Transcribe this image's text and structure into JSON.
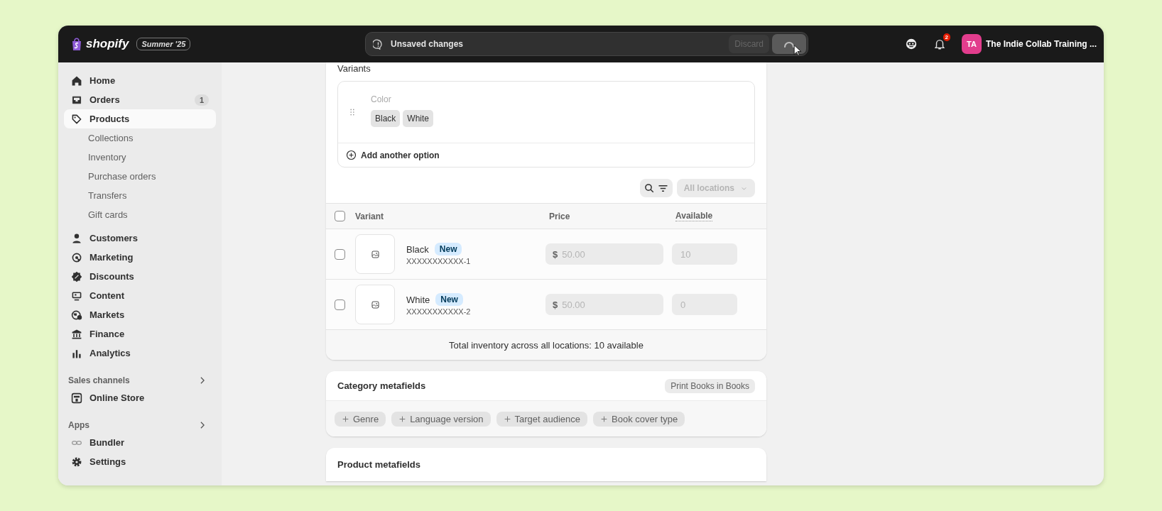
{
  "topbar": {
    "logo": "shopify",
    "edition": "Summer '25",
    "unsaved": {
      "message": "Unsaved changes",
      "discard": "Discard"
    },
    "notifications": {
      "count": "2"
    },
    "account": {
      "initials": "TA",
      "name": "The Indie Collab Training ..."
    }
  },
  "sidebar": {
    "items": [
      {
        "label": "Home",
        "kind": "home",
        "selected": false
      },
      {
        "label": "Orders",
        "kind": "orders",
        "selected": false,
        "badge": "1"
      },
      {
        "label": "Products",
        "kind": "products",
        "selected": true,
        "children": [
          {
            "label": "Collections"
          },
          {
            "label": "Inventory"
          },
          {
            "label": "Purchase orders"
          },
          {
            "label": "Transfers"
          },
          {
            "label": "Gift cards"
          }
        ]
      },
      {
        "label": "Customers",
        "kind": "customers",
        "selected": false
      },
      {
        "label": "Marketing",
        "kind": "marketing",
        "selected": false
      },
      {
        "label": "Discounts",
        "kind": "discounts",
        "selected": false
      },
      {
        "label": "Content",
        "kind": "content",
        "selected": false
      },
      {
        "label": "Markets",
        "kind": "markets",
        "selected": false
      },
      {
        "label": "Finance",
        "kind": "finance",
        "selected": false
      },
      {
        "label": "Analytics",
        "kind": "analytics",
        "selected": false
      }
    ],
    "sections": [
      {
        "title": "Sales channels",
        "items": [
          {
            "label": "Online Store",
            "kind": "store"
          }
        ]
      },
      {
        "title": "Apps",
        "items": [
          {
            "label": "Bundler",
            "kind": "bundler"
          },
          {
            "label": "Settings",
            "kind": "settings"
          }
        ]
      }
    ]
  },
  "variants": {
    "title": "Variants",
    "option": {
      "name": "Color",
      "values": [
        "Black",
        "White"
      ]
    },
    "add_option": "Add another option",
    "locations": "All locations",
    "columns": [
      "Variant",
      "Price",
      "Available"
    ],
    "header_checked": false,
    "rows": [
      {
        "name": "Black",
        "badge": "New",
        "sku": "XXXXXXXXXXX-1",
        "currency": "$",
        "price": "50.00",
        "available": "10",
        "checked": false
      },
      {
        "name": "White",
        "badge": "New",
        "sku": "XXXXXXXXXXX-2",
        "currency": "$",
        "price": "50.00",
        "available": "0",
        "checked": false
      }
    ],
    "total": "Total inventory across all locations: 10 available"
  },
  "category_metafields": {
    "title": "Category metafields",
    "category": "Print Books in Books",
    "fields": [
      "Genre",
      "Language version",
      "Target audience",
      "Book cover type"
    ]
  },
  "product_metafields": {
    "title": "Product metafields"
  }
}
